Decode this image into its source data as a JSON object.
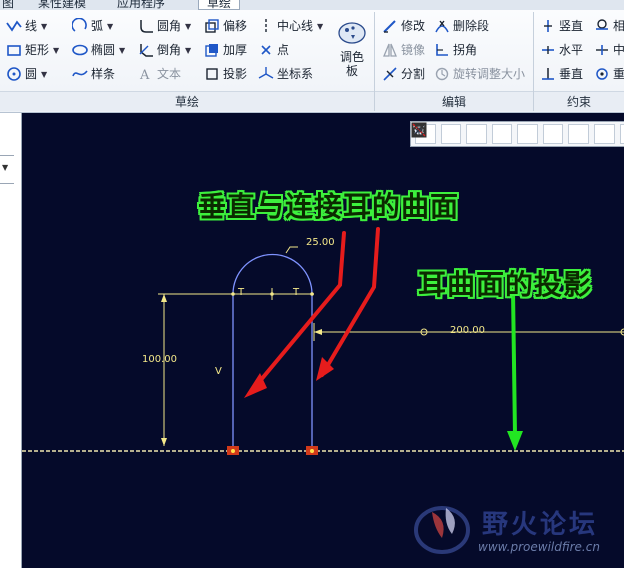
{
  "tabs": [
    {
      "label": "图",
      "active": false
    },
    {
      "label": "某性建模",
      "active": false
    },
    {
      "label": "应用程序",
      "active": false
    },
    {
      "label": "草绘",
      "active": true
    }
  ],
  "ribbon": {
    "sketch": {
      "line": "线",
      "arc": "弧",
      "rectangle": "矩形",
      "ellipse": "椭圆",
      "circle": "圆",
      "spline": "样条",
      "fillet": "圆角",
      "chamfer": "倒角",
      "text": "文本",
      "offset": "偏移",
      "thicken": "加厚",
      "project": "投影",
      "centerline": "中心线",
      "point": "点",
      "coordsys": "坐标系",
      "palette_line1": "调色",
      "palette_line2": "板",
      "group_label": "草绘"
    },
    "edit": {
      "modify": "修改",
      "delete_segment": "删除段",
      "mirror": "镜像",
      "corner": "拐角",
      "divide": "分割",
      "rotate_resize": "旋转调整大小",
      "group_label": "编辑"
    },
    "constrain": {
      "vertical": "竖直",
      "tangent": "相",
      "horizontal": "水平",
      "midpoint": "中",
      "perpendicular": "垂直",
      "coincident": "重",
      "group_label": "约束"
    }
  },
  "canvas": {
    "dimensions": {
      "radius": "25.00",
      "height": "100.00",
      "distance": "200.00"
    },
    "constraint_marks": {
      "t1": "T",
      "t2": "T",
      "v": "V"
    },
    "annotations": {
      "top": "垂直与连接耳的曲面",
      "right": "耳曲面的投影"
    },
    "colors": {
      "background": "#050a2a",
      "sketch": "#7f93ff",
      "dimension": "#f4e88a",
      "arrow_red": "#e61c1c",
      "arrow_green": "#22e622"
    }
  },
  "watermark": {
    "name": "野火论坛",
    "url": "www.proewildfire.cn"
  }
}
